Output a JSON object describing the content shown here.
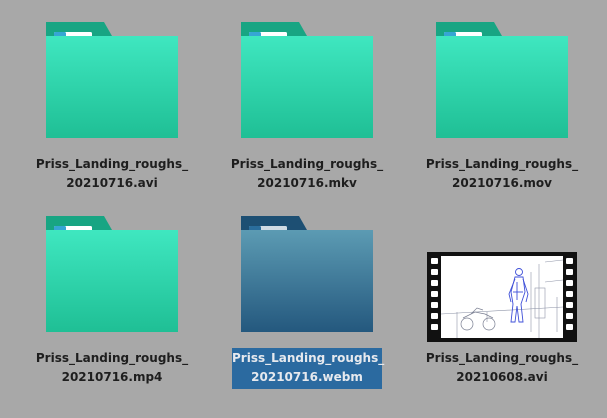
{
  "colors": {
    "background": "#a8a8a8",
    "folder_top": "#3fe7c0",
    "folder_bottom": "#1fbf95",
    "folder_tab": "#18a583",
    "folder_selected_top": "#5c9bb3",
    "folder_selected_bottom": "#24587e",
    "folder_selected_tab": "#1d4f73",
    "selection_bg": "#2b6aa0"
  },
  "files": [
    {
      "name_line1": "Priss_Landing_roughs_",
      "name_line2": "20210716.avi",
      "kind": "folder-icon",
      "selected": false
    },
    {
      "name_line1": "Priss_Landing_roughs_",
      "name_line2": "20210716.mkv",
      "kind": "folder-icon",
      "selected": false
    },
    {
      "name_line1": "Priss_Landing_roughs_",
      "name_line2": "20210716.mov",
      "kind": "folder-icon",
      "selected": false
    },
    {
      "name_line1": "Priss_Landing_roughs_",
      "name_line2": "20210716.mp4",
      "kind": "folder-icon",
      "selected": false
    },
    {
      "name_line1": "Priss_Landing_roughs_",
      "name_line2": "20210716.webm",
      "kind": "folder-icon",
      "selected": true
    },
    {
      "name_line1": "Priss_Landing_roughs_",
      "name_line2": "20210608.avi",
      "kind": "video-thumbnail-icon",
      "selected": false
    }
  ]
}
